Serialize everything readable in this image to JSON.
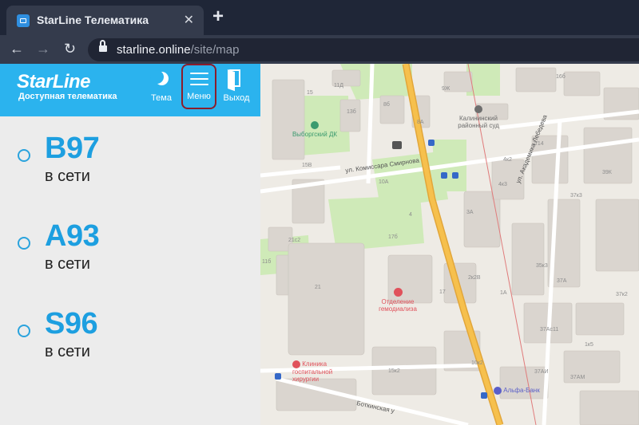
{
  "browser": {
    "tab_title": "StarLine Телематика",
    "tab_close": "✕",
    "new_tab": "+",
    "back": "←",
    "forward": "→",
    "reload": "↻",
    "url_host": "starline.online",
    "url_path": "/site/map"
  },
  "header": {
    "logo": "StarLine",
    "tagline": "Доступная телематика",
    "buttons": {
      "theme": "Тема",
      "menu": "Меню",
      "exit": "Выход"
    }
  },
  "cars": [
    {
      "name": "B97",
      "status": "в сети"
    },
    {
      "name": "A93",
      "status": "в сети"
    },
    {
      "name": "S96",
      "status": "в сети"
    }
  ],
  "map": {
    "streets": {
      "komissara": "ул. Комиссара Смирнова",
      "akademika": "ул. Академика Лебедева",
      "botkinskaya": "Боткинская у"
    },
    "pois": {
      "vyborgsky": "Выборгский ДК",
      "court": "Калининский районный суд",
      "dialysis": "Отделение гемодиализа",
      "clinic": "Клиника госпитальной хирургии",
      "bank": "Альфа-Банк"
    },
    "houses": [
      "11Д",
      "15",
      "13б",
      "8б",
      "8А",
      "9Ж",
      "16б",
      "15В",
      "10А",
      "4к2",
      "4к3",
      "39К",
      "37к3",
      "21с2",
      "17б",
      "11б",
      "4",
      "3А",
      "2/14",
      "35к3",
      "37А",
      "2к2В",
      "21",
      "17",
      "1А",
      "37к2",
      "37Ас11",
      "10к2",
      "1к5",
      "15к2",
      "37АИ",
      "37АМ"
    ],
    "colors": {
      "background": "#eeebe5",
      "block": "#dad5cf",
      "park": "#cfeab8",
      "major_road": "#f6c04d",
      "road": "#ffffff",
      "rail": "#e07b7b"
    }
  }
}
